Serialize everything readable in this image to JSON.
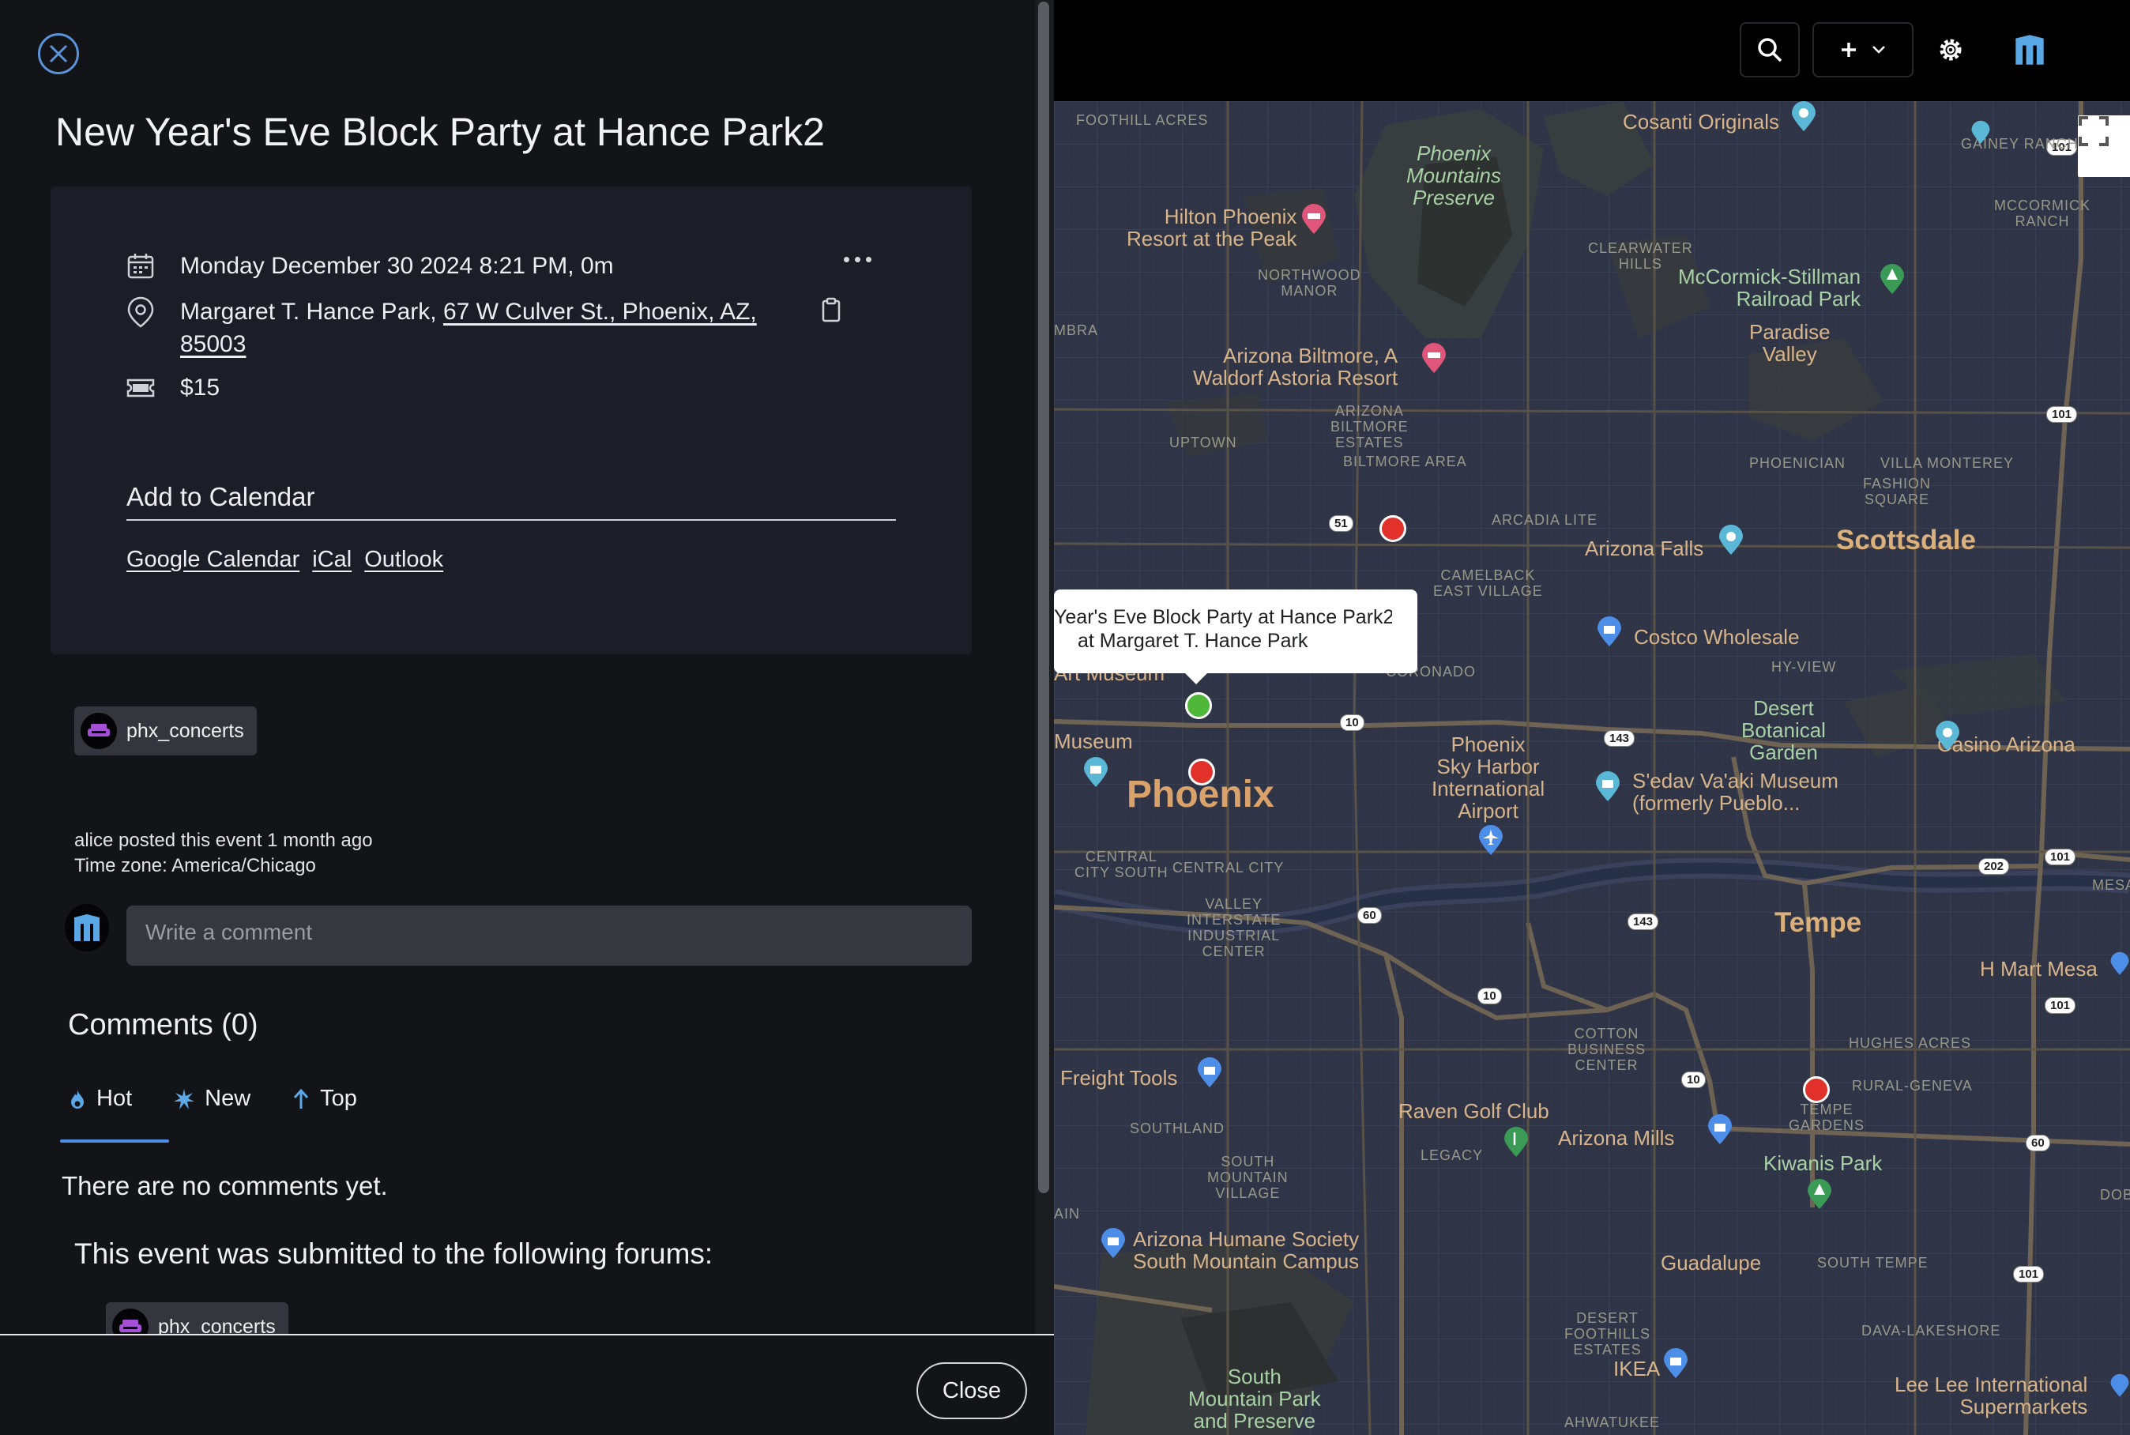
{
  "event": {
    "title": "New Year's Eve Block Party at Hance Park2",
    "datetime": "Monday December 30 2024 8:21 PM, 0m",
    "venue": "Margaret T. Hance Park,",
    "address_line1": "67 W Culver St., Phoenix, AZ,",
    "address_line2": "85003",
    "price": "$15"
  },
  "add_to_calendar": {
    "label": "Add to Calendar",
    "links": [
      "Google Calendar",
      "iCal",
      "Outlook"
    ]
  },
  "forum": {
    "name": "phx_concerts"
  },
  "meta": {
    "posted": "alice posted this event 1 month ago",
    "timezone": "Time zone: America/Chicago"
  },
  "comment": {
    "placeholder": "Write a comment"
  },
  "comments": {
    "heading": "Comments (0)",
    "tabs": [
      "Hot",
      "New",
      "Top"
    ],
    "empty": "There are no comments yet.",
    "forums_heading": "This event was submitted to the following forums:"
  },
  "footer": {
    "close_label": "Close"
  },
  "topbar": {
    "icons": [
      "search-icon",
      "plus-icon",
      "chevron-down-icon",
      "gear-icon",
      "logo-icon"
    ]
  },
  "map": {
    "popup": {
      "title": "Year's Eve Block Party at Hance Park2",
      "subtitle": "at Margaret T. Hance Park"
    },
    "cities": [
      "Phoenix",
      "Scottsdale",
      "Tempe"
    ],
    "places": {
      "cosanti": "Cosanti Originals",
      "phx_preserve": "Phoenix\nMountains\nPreserve",
      "hilton": "Hilton Phoenix\nResort at the Peak",
      "mccormick": "McCormick-Stillman\nRailroad Park",
      "paradise": "Paradise\nValley",
      "biltmore": "Arizona Biltmore, A\nWaldorf Astoria Resort",
      "az_falls": "Arizona Falls",
      "costco": "Costco Wholesale",
      "art_museum": "Art Museum",
      "museum": "Museum",
      "desert_botanical": "Desert\nBotanical\nGarden",
      "casino": "Casino Arizona",
      "sky_harbor": "Phoenix\nSky Harbor\nInternational\nAirport",
      "sedav": "S'edav Va'aki Museum\n(formerly Pueblo...",
      "hmart": "H Mart Mesa",
      "freight": "Freight Tools",
      "raven": "Raven Golf Club",
      "az_mills": "Arizona Mills",
      "kiwanis": "Kiwanis Park",
      "humane": "Arizona Humane Society\nSouth Mountain Campus",
      "guadalupe": "Guadalupe",
      "ikea": "IKEA",
      "south_mountain": "South\nMountain Park\nand Preserve",
      "lee_lee": "Lee Lee International\nSupermarkets"
    },
    "districts": {
      "foothill": "FOOTHILL ACRES",
      "gainey": "GAINEY RANCH",
      "mccormick_ranch": "MCCORMICK\nRANCH",
      "clearwater": "CLEARWATER\nHILLS",
      "northwood": "NORTHWOOD\nMANOR",
      "mbra": "MBRA",
      "uptown": "UPTOWN",
      "biltmore_estates": "ARIZONA\nBILTMORE\nESTATES",
      "biltmore_area": "BILTMORE AREA",
      "phoenician": "PHOENICIAN",
      "villa_monterey": "VILLA MONTEREY",
      "fashion_square": "FASHION\nSQUARE",
      "arcadia_lite": "ARCADIA LITE",
      "camelback": "CAMELBACK\nEAST VILLAGE",
      "coronado": "CORONADO",
      "hy_view": "HY-VIEW",
      "central_south": "CENTRAL\nCITY SOUTH",
      "central_city": "CENTRAL CITY",
      "valley_interstate": "VALLEY\nINTERSTATE\nINDUSTRIAL\nCENTER",
      "mesa_gr": "MESA GR",
      "hughes": "HUGHES ACRES",
      "rural_geneva": "RURAL-GENEVA",
      "tempe_gardens": "TEMPE\nGARDENS",
      "cotton": "COTTON\nBUSINESS\nCENTER",
      "southland": "SOUTHLAND",
      "south_mountain_village": "SOUTH\nMOUNTAIN\nVILLAGE",
      "legacy": "LEGACY",
      "south_tempe": "SOUTH TEMPE",
      "dob": "DOB",
      "ain": "AIN",
      "desert_foothills": "DESERT\nFOOTHILLS\nESTATES",
      "dava": "DAVA-LAKESHORE",
      "ahwatukee": "AHWATUKEE"
    },
    "shields": [
      "101",
      "101",
      "101",
      "101",
      "101",
      "51",
      "10",
      "143",
      "143",
      "202",
      "60",
      "10",
      "10",
      "60"
    ]
  }
}
